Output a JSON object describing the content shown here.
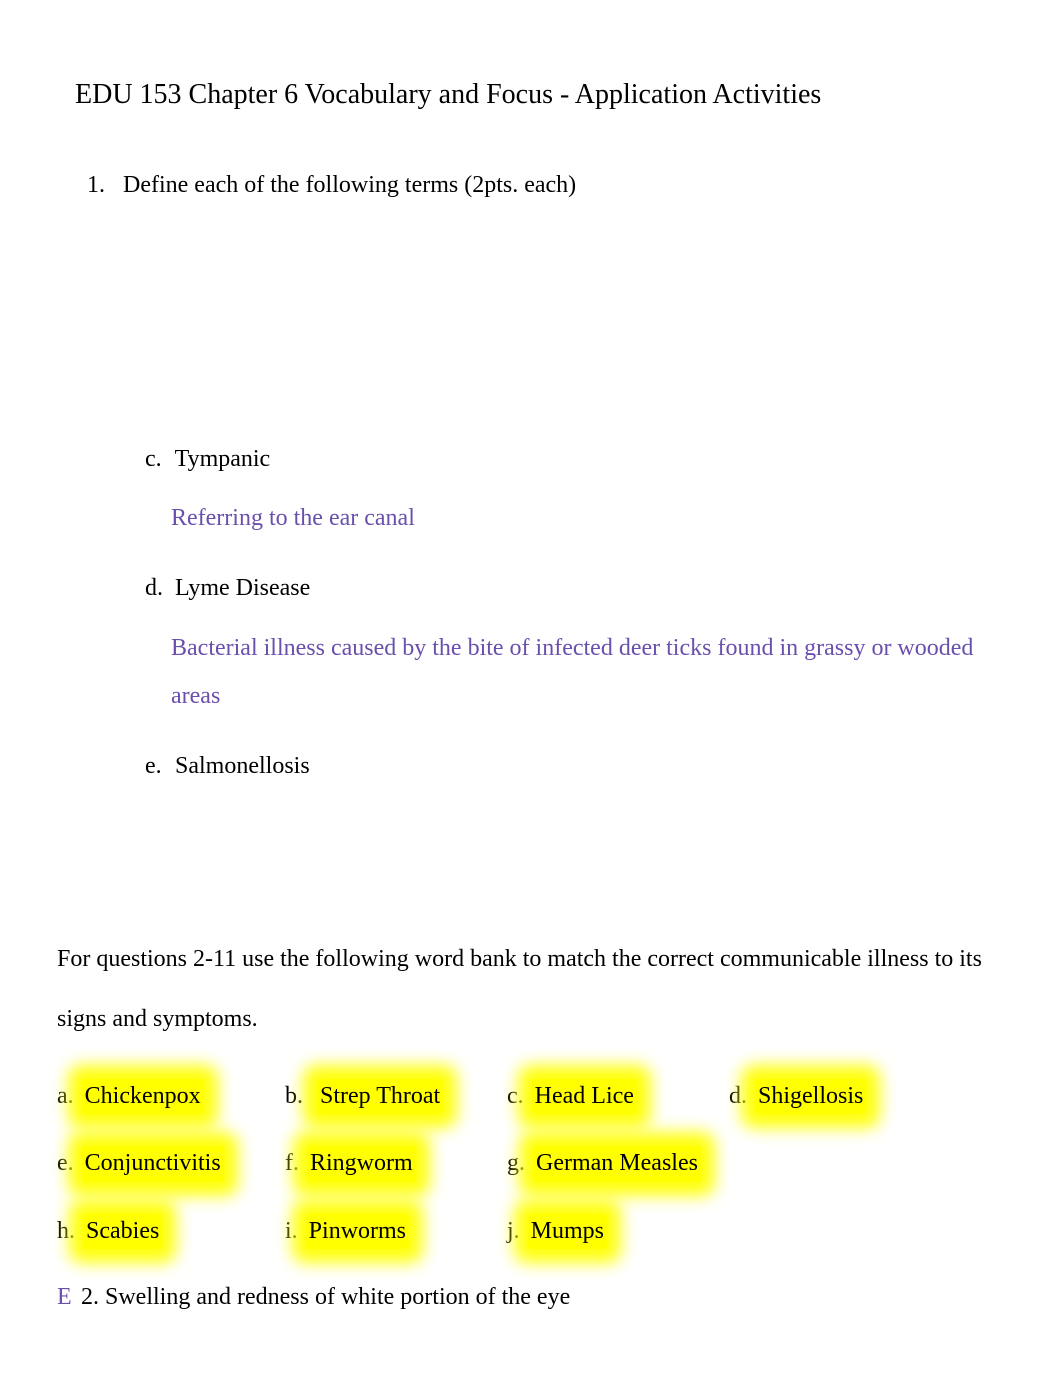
{
  "title": "EDU 153 Chapter 6 Vocabulary and Focus - Application Activities",
  "q1": {
    "number": "1.",
    "text": "Define each of the following terms (2pts. each)"
  },
  "items": {
    "c": {
      "letter": "c.",
      "term": "Tympanic",
      "def": "Referring to the ear canal"
    },
    "d": {
      "letter": "d.",
      "term": " Lyme Disease",
      "def": "Bacterial illness caused by the bite of infected deer ticks found in grassy or wooded areas"
    },
    "e": {
      "letter": "e.",
      "term": "Salmonellosis"
    }
  },
  "for_questions": "For questions 2-11 use the following word bank to match the correct communicable illness to its signs and symptoms.",
  "bank": {
    "a": {
      "letter": "a.",
      "word": "Chickenpox"
    },
    "b": {
      "letter": "b.",
      "word": "Strep Throat"
    },
    "c": {
      "letter": "c.",
      "word": "Head Lice"
    },
    "d": {
      "letter": "d.",
      "word": "Shigellosis"
    },
    "e": {
      "letter": "e.",
      "word": "Conjunctivitis"
    },
    "f": {
      "letter": "f.",
      "word": "Ringworm"
    },
    "g": {
      "letter": "g.",
      "word": "German Measles"
    },
    "h": {
      "letter": "h.",
      "word": "Scabies"
    },
    "i": {
      "letter": "i.",
      "word": "Pinworms"
    },
    "j": {
      "letter": "j.",
      "word": "Mumps"
    }
  },
  "q2": {
    "answer": "E",
    "text": "2. Swelling and redness of white portion of the eye"
  }
}
